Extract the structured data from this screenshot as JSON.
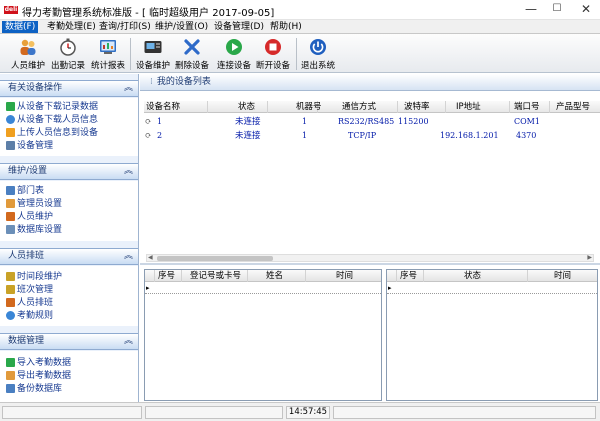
{
  "window": {
    "logo_text": "deli",
    "title": "得力考勤管理系统标准版 - [ 临时超级用户 2017-09-05]",
    "min_glyph": "—",
    "max_glyph": "☐",
    "close_glyph": "✕"
  },
  "menu": {
    "items": [
      {
        "label": "数据(F)"
      },
      {
        "label": "考勤处理(E)"
      },
      {
        "label": "查询/打印(S)"
      },
      {
        "label": "维护/设置(O)"
      },
      {
        "label": "设备管理(D)"
      },
      {
        "label": "帮助(H)"
      }
    ]
  },
  "toolbar": {
    "buttons": [
      {
        "label": "人员维护",
        "icon": "people-icon"
      },
      {
        "label": "出勤记录",
        "icon": "stopwatch-icon"
      },
      {
        "label": "统计报表",
        "icon": "report-icon"
      },
      {
        "label": "设备维护",
        "icon": "device-icon"
      },
      {
        "label": "删除设备",
        "icon": "delete-x-icon"
      },
      {
        "label": "连接设备",
        "icon": "play-icon"
      },
      {
        "label": "断开设备",
        "icon": "stop-icon"
      },
      {
        "label": "退出系统",
        "icon": "power-icon"
      }
    ]
  },
  "sidebar": {
    "sections": [
      {
        "title": "有关设备操作",
        "items": [
          {
            "label": "从设备下载记录数据",
            "icon": "download-arrow-icon"
          },
          {
            "label": "从设备下载人员信息",
            "icon": "globe-icon"
          },
          {
            "label": "上传人员信息到设备",
            "icon": "upload-arrow-icon"
          },
          {
            "label": "设备管理",
            "icon": "device-icon"
          }
        ]
      },
      {
        "title": "维护/设置",
        "items": [
          {
            "label": "部门表",
            "icon": "org-icon"
          },
          {
            "label": "管理员设置",
            "icon": "admin-icon"
          },
          {
            "label": "人员维护",
            "icon": "people-icon"
          },
          {
            "label": "数据库设置",
            "icon": "database-icon"
          }
        ]
      },
      {
        "title": "人员排班",
        "items": [
          {
            "label": "时间段维护",
            "icon": "calendar-icon"
          },
          {
            "label": "班次管理",
            "icon": "calendar-icon"
          },
          {
            "label": "人员排班",
            "icon": "people-icon"
          },
          {
            "label": "考勤规则",
            "icon": "globe-icon"
          }
        ]
      },
      {
        "title": "数据管理",
        "items": [
          {
            "label": "导入考勤数据",
            "icon": "import-icon"
          },
          {
            "label": "导出考勤数据",
            "icon": "export-icon"
          },
          {
            "label": "备份数据库",
            "icon": "backup-icon"
          }
        ]
      }
    ]
  },
  "device_list": {
    "title": "我的设备列表",
    "columns": [
      "设备名称",
      "状态",
      "机器号",
      "通信方式",
      "波特率",
      "IP地址",
      "端口号",
      "产品型号"
    ],
    "rows": [
      {
        "name": "1",
        "status": "未连接",
        "machine_no": "1",
        "comm": "RS232/RS485",
        "baud": "115200",
        "ip": "",
        "port": "COM1",
        "model": ""
      },
      {
        "name": "2",
        "status": "未连接",
        "machine_no": "1",
        "comm": "TCP/IP",
        "baud": "",
        "ip": "192.168.1.201",
        "port": "4370",
        "model": ""
      }
    ]
  },
  "records_left": {
    "columns": [
      "序号",
      "登记号或卡号",
      "姓名",
      "时间"
    ]
  },
  "records_right": {
    "columns": [
      "序号",
      "状态",
      "时间"
    ]
  },
  "statusbar": {
    "time": "14:57:45"
  },
  "colors": {
    "accent": "#0e62c4",
    "link": "#1a3c92",
    "cell_text": "#0018a8",
    "close_red": "#d0121b"
  }
}
